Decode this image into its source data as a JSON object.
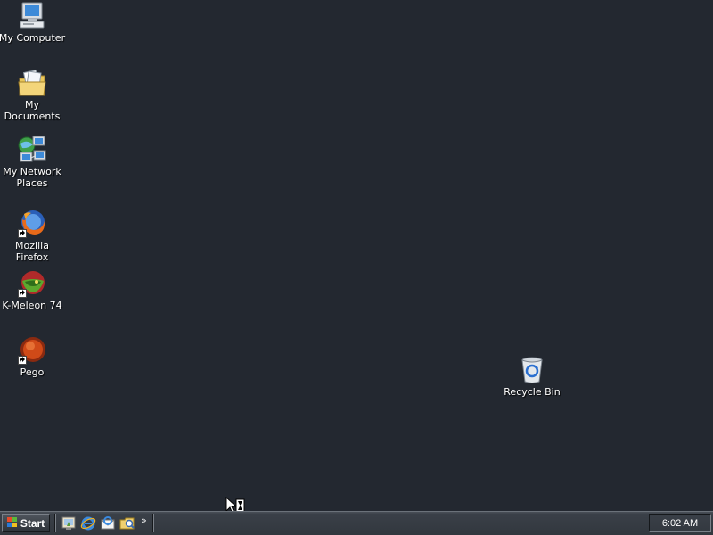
{
  "desktop": {
    "background_color": "#232830",
    "icons": [
      {
        "label": "My Computer",
        "icon": "my-computer-icon"
      },
      {
        "label": "My Documents",
        "icon": "my-documents-icon"
      },
      {
        "label": "My Network\nPlaces",
        "icon": "network-places-icon"
      },
      {
        "label": "Mozilla Firefox",
        "icon": "firefox-icon"
      },
      {
        "label": "K-Meleon 74",
        "icon": "kmeleon-icon"
      },
      {
        "label": "Pego",
        "icon": "pego-icon"
      },
      {
        "label": "Recycle Bin",
        "icon": "recycle-bin-icon"
      }
    ]
  },
  "taskbar": {
    "start_label": "Start",
    "quick_launch": [
      {
        "icon": "show-desktop-icon"
      },
      {
        "icon": "internet-explorer-icon"
      },
      {
        "icon": "outlook-express-icon"
      },
      {
        "icon": "windows-explorer-icon"
      }
    ],
    "more_label": "»",
    "clock": "6:02 AM"
  }
}
